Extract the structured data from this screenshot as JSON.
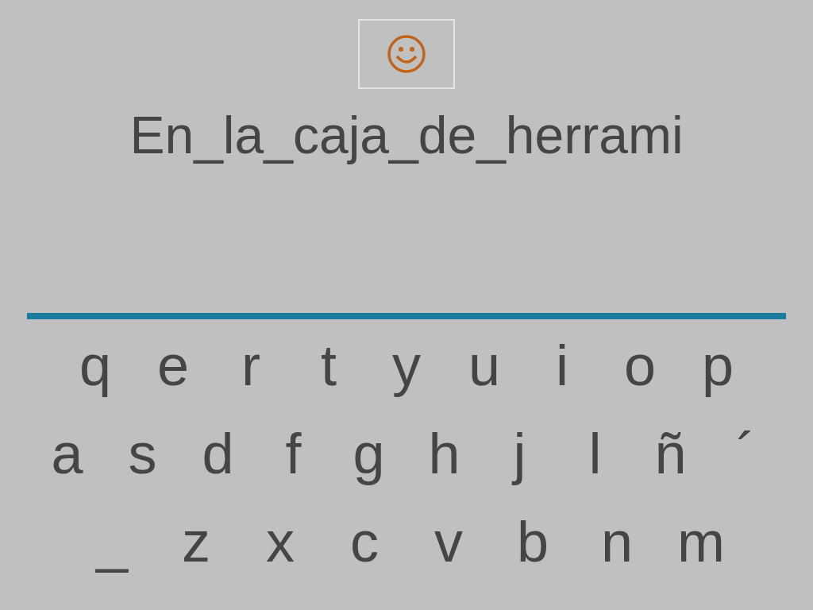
{
  "phrase": "En_la_caja_de_herrami",
  "keyboard": {
    "rows": [
      [
        "q",
        "e",
        "r",
        "t",
        "y",
        "u",
        "i",
        "o",
        "p"
      ],
      [
        "a",
        "s",
        "d",
        "f",
        "g",
        "h",
        "j",
        "l",
        "ñ",
        "´"
      ],
      [
        "_",
        "z",
        "x",
        "c",
        "v",
        "b",
        "n",
        "m"
      ]
    ]
  }
}
